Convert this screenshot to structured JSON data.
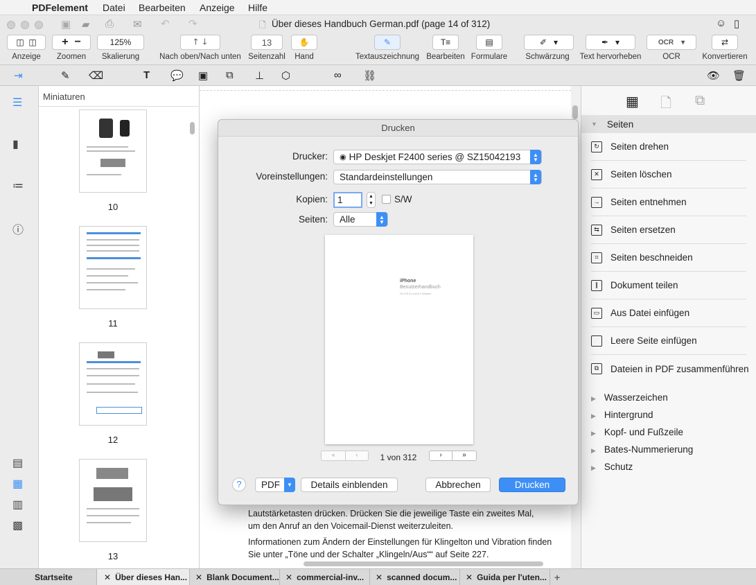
{
  "menubar": {
    "app": "PDFelement",
    "items": [
      "Datei",
      "Bearbeiten",
      "Anzeige",
      "Hilfe"
    ]
  },
  "window": {
    "title": "Über dieses Handbuch  German.pdf (page 14 of 312)"
  },
  "toolbar": {
    "zoom_value": "125%",
    "page_number": "13",
    "labels": {
      "anzeige": "Anzeige",
      "zoomen": "Zoomen",
      "skalierung": "Skalierung",
      "nach_oben": "Nach oben/Nach unten",
      "seitenzahl": "Seitenzahl",
      "hand": "Hand",
      "textauszeichnung": "Textauszeichnung",
      "bearbeiten": "Bearbeiten",
      "formulare": "Formulare",
      "schwaerzung": "Schwärzung",
      "text_hervorheben": "Text hervorheben",
      "ocr": "OCR",
      "konvertieren": "Konvertieren"
    }
  },
  "thumbnails": {
    "header": "Miniaturen",
    "pages": [
      "10",
      "11",
      "12",
      "13"
    ]
  },
  "document": {
    "para1": "Lautstärketasten drücken. Drücken Sie die jeweilige Taste ein zweites Mal, um den Anruf an den Voicemail-Dienst weiterzuleiten.",
    "para2": "Informationen zum Ändern der Einstellungen für Klingelton und Vibration finden Sie unter „Töne und der Schalter „Klingeln/Aus““ auf Seite 227."
  },
  "dialog": {
    "title": "Drucken",
    "printer_label": "Drucker:",
    "printer_value": "HP Deskjet F2400 series @ SZ15042193",
    "presets_label": "Voreinstellungen:",
    "presets_value": "Standardeinstellungen",
    "copies_label": "Kopien:",
    "copies_value": "1",
    "bw_label": "S/W",
    "pages_label": "Seiten:",
    "pages_value": "Alle",
    "preview": {
      "title": "iPhone",
      "subtitle": "Benutzerhandbuch",
      "small": "Für iOS 8.4 und 8.1 Software"
    },
    "page_indicator": "1 von 312",
    "help": "?",
    "pdf_button": "PDF",
    "details_button": "Details einblenden",
    "cancel_button": "Abbrechen",
    "print_button": "Drucken"
  },
  "right_panel": {
    "section_pages": "Seiten",
    "page_items": [
      "Seiten drehen",
      "Seiten löschen",
      "Seiten entnehmen",
      "Seiten ersetzen",
      "Seiten beschneiden",
      "Dokument teilen",
      "Aus Datei einfügen",
      "Leere Seite einfügen",
      "Dateien in PDF zusammenführen"
    ],
    "sections": [
      "Wasserzeichen",
      "Hintergrund",
      "Kopf- und Fußzeile",
      "Bates-Nummerierung",
      "Schutz"
    ]
  },
  "tabs": [
    "Startseite",
    "Über dieses Han...",
    "Blank Document...",
    "commercial-inv...",
    "scanned docum...",
    "Guida per l'uten..."
  ],
  "colors": {
    "accent": "#3d8ff5",
    "window_bg": "#ececec"
  }
}
